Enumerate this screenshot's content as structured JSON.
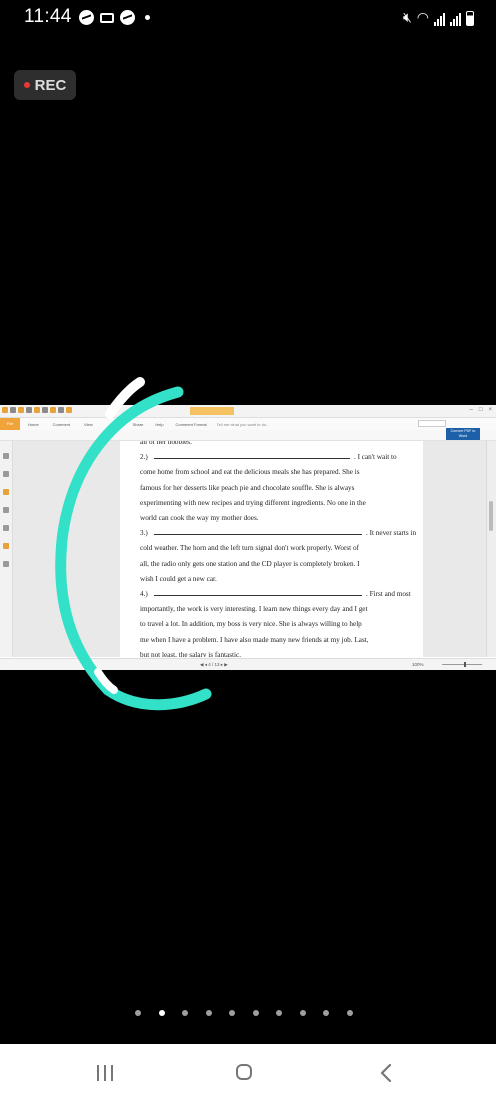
{
  "status_bar": {
    "time": "11:44"
  },
  "rec_badge": {
    "label": "REC"
  },
  "pdf_app": {
    "ribbon_tabs": [
      "File",
      "Home",
      "Comment",
      "View"
    ],
    "ribbon_tabs_right": [
      "Share",
      "Help",
      "Comment Format"
    ],
    "tell_me": "Tell me what you want to do...",
    "convert_label": "Convert PDF to Word",
    "page_indicator": "4 / 13",
    "zoom": "100%"
  },
  "document": {
    "top_partial_line": "all of her hobbies.",
    "items": [
      {
        "number": "2.)",
        "after_blank": ". I can't wait to",
        "lines": [
          "come home from school and eat the delicious meals she has prepared. She is",
          "famous for her desserts like peach pie and chocolate souffle. She is always",
          "experimenting with new recipes and trying different ingredients. No one in the",
          "world can cook the way my mother does."
        ]
      },
      {
        "number": "3.)",
        "after_blank": ". It never starts in",
        "lines": [
          "cold weather. The horn and the left turn signal don't work properly. Worst of",
          "all, the radio only gets one station and the CD player is completely broken. I",
          "wish I could get a new car."
        ]
      },
      {
        "number": "4.)",
        "after_blank": ". First and most",
        "lines": [
          "importantly, the work is very interesting. I learn new things every day and I get",
          "to travel a lot. In addition, my boss is very nice. She is always willing to help",
          "me when I have a problem. I have also made many new friends at my job. Last,",
          "but not least, the salary is fantastic."
        ]
      }
    ]
  },
  "drawing": {
    "stroke_colors": {
      "white": "#ffffff",
      "teal": "#33e0c8"
    }
  },
  "pagination": {
    "count": 10,
    "active_index": 1
  },
  "nav_bar": {
    "icons": [
      "recents-icon",
      "home-icon",
      "back-icon"
    ]
  }
}
